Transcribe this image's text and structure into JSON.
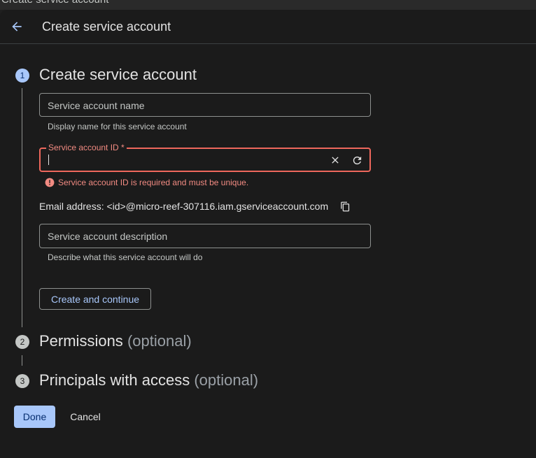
{
  "window": {
    "title": "Create service account"
  },
  "header": {
    "title": "Create service account",
    "back_icon": "arrow-back-icon"
  },
  "steps": [
    {
      "number": "1",
      "title": "Create service account",
      "optional": "",
      "state": "active"
    },
    {
      "number": "2",
      "title": "Permissions",
      "optional": "(optional)",
      "state": "inactive"
    },
    {
      "number": "3",
      "title": "Principals with access",
      "optional": "(optional)",
      "state": "inactive"
    }
  ],
  "form": {
    "name_field": {
      "placeholder": "Service account name",
      "value": "",
      "hint": "Display name for this service account"
    },
    "id_field": {
      "label": "Service account ID *",
      "value": "",
      "error": "Service account ID is required and must be unique."
    },
    "email": {
      "text": "Email address: <id>@micro-reef-307116.iam.gserviceaccount.com"
    },
    "description_field": {
      "placeholder": "Service account description",
      "value": "",
      "hint": "Describe what this service account will do"
    },
    "create_button": "Create and continue"
  },
  "footer": {
    "done_label": "Done",
    "cancel_label": "Cancel"
  },
  "colors": {
    "accent": "#a8c7fa",
    "error": "#f28b82",
    "background": "#1b1b1b"
  }
}
